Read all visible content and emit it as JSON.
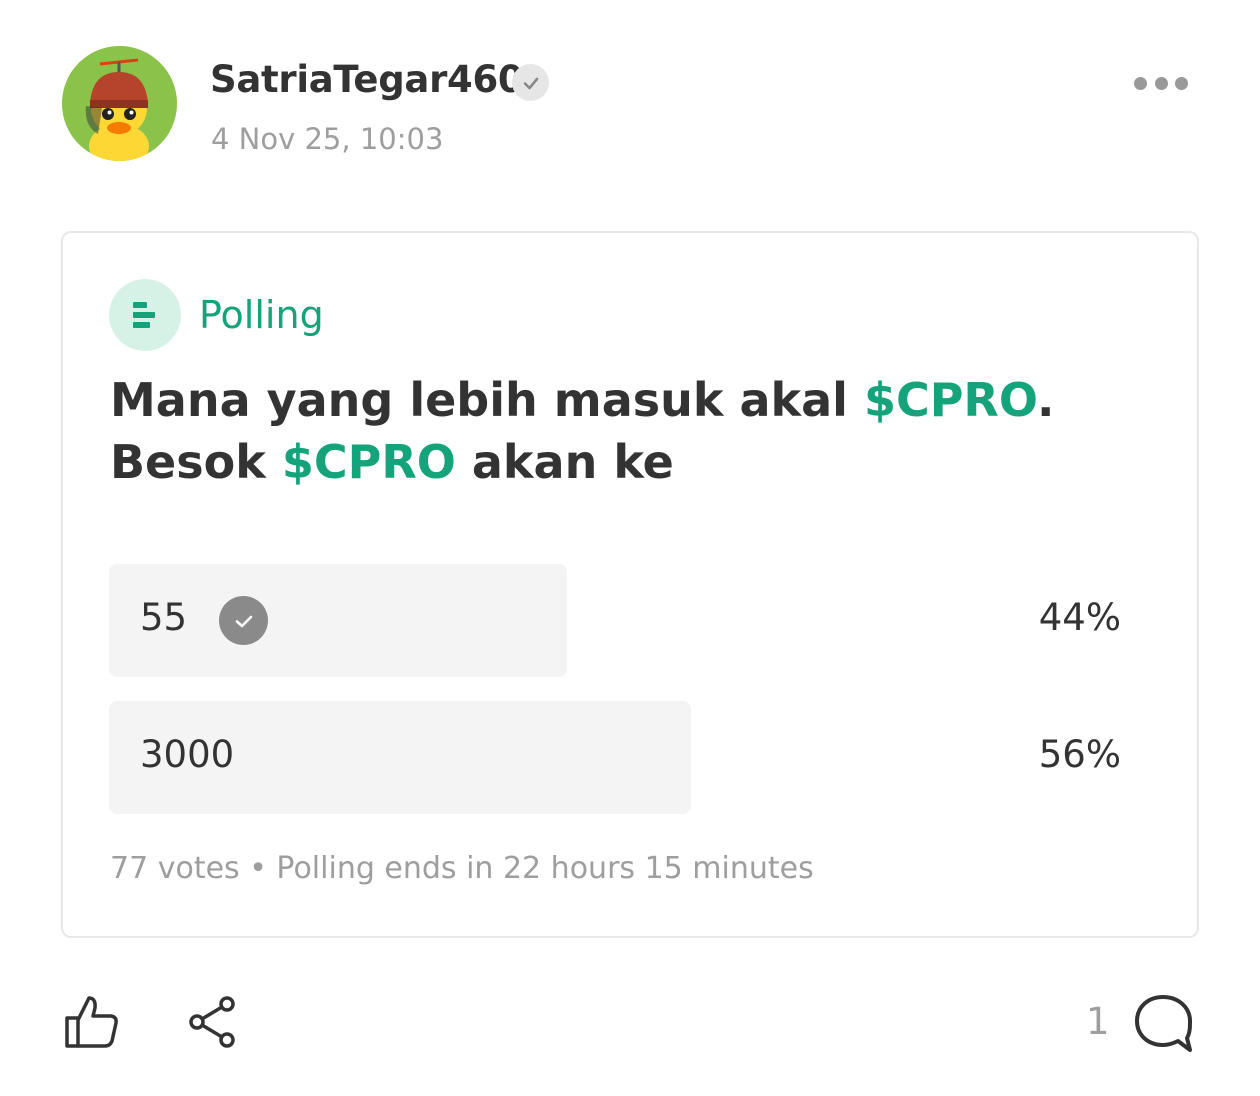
{
  "post": {
    "username": "SatriaTegar460",
    "timestamp": "4 Nov 25, 10:03"
  },
  "icons": {
    "verified": "check-badge-icon",
    "more": "more-horizontal-icon",
    "poll": "poll-bars-icon",
    "selected": "check-circle-icon",
    "like": "thumbs-up-icon",
    "share": "share-icon",
    "comment": "comment-bubble-icon"
  },
  "poll": {
    "label": "Polling",
    "question_part1": "Mana yang lebih masuk akal ",
    "ticker1": "$CPRO",
    "question_part2": ".",
    "question_part3": "Besok ",
    "ticker2": "$CPRO",
    "question_part4": " akan ke",
    "options": [
      {
        "label": "55",
        "percent": "44%",
        "fraction": 0.44,
        "selected": true
      },
      {
        "label": "3000",
        "percent": "56%",
        "fraction": 0.56,
        "selected": false
      }
    ],
    "footer": "77 votes • Polling ends in 22 hours 15 minutes"
  },
  "actions": {
    "comment_count": "1"
  },
  "colors": {
    "accent": "#14a37a",
    "badge_bg": "#d6f1e6",
    "bar": "#f4f4f4",
    "muted": "#9e9e9e",
    "text": "#333333"
  }
}
